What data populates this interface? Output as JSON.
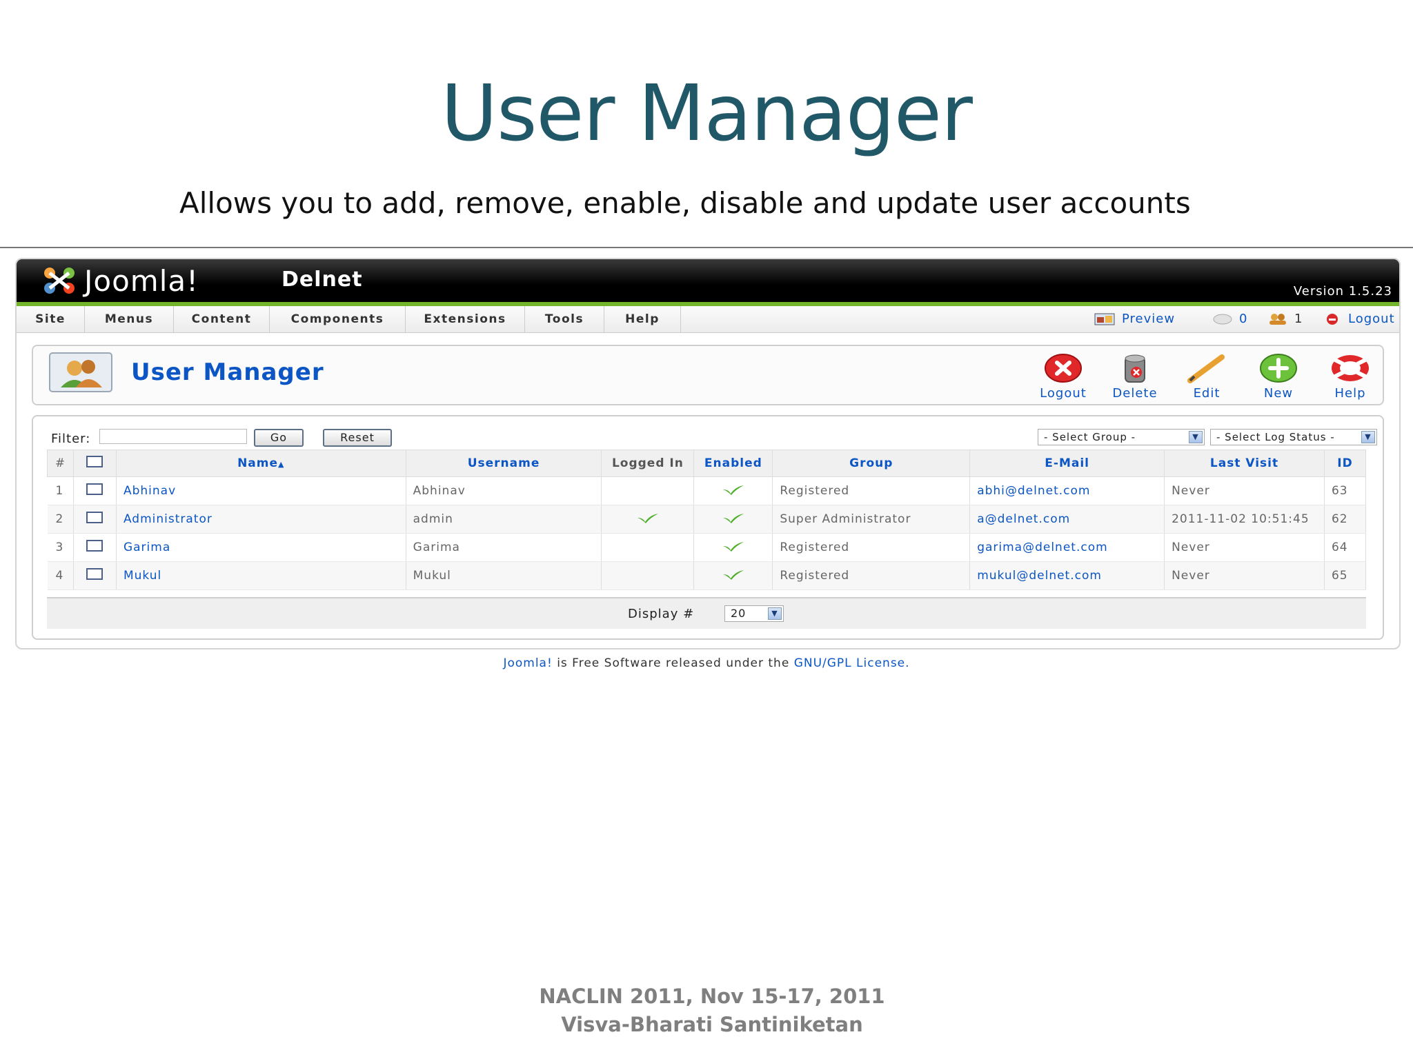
{
  "slide": {
    "title": "User Manager",
    "subtitle": "Allows you to add, remove, enable, disable and update user accounts",
    "footer_line1": "NACLIN 2011, Nov 15-17, 2011",
    "footer_line2": "Visva-Bharati Santiniketan"
  },
  "app": {
    "logo_text": "Joomla!",
    "site_name": "Delnet",
    "version": "Version 1.5.23"
  },
  "menu": [
    "Site",
    "Menus",
    "Content",
    "Components",
    "Extensions",
    "Tools",
    "Help"
  ],
  "status": {
    "preview": "Preview",
    "messages": "0",
    "users_online": "1",
    "logout": "Logout"
  },
  "header": {
    "title": "User Manager"
  },
  "toolbar": {
    "logout": "Logout",
    "delete": "Delete",
    "edit": "Edit",
    "new": "New",
    "help": "Help"
  },
  "filter": {
    "label": "Filter:",
    "value": "",
    "go": "Go",
    "reset": "Reset",
    "group_select": "- Select Group -",
    "log_status_select": "- Select Log Status -"
  },
  "table": {
    "columns": [
      "#",
      "",
      "Name",
      "Username",
      "Logged In",
      "Enabled",
      "Group",
      "E-Mail",
      "Last Visit",
      "ID"
    ],
    "rows": [
      {
        "num": "1",
        "name": "Abhinav",
        "username": "Abhinav",
        "logged_in": false,
        "enabled": true,
        "group": "Registered",
        "email": "abhi@delnet.com",
        "last_visit": "Never",
        "id": "63"
      },
      {
        "num": "2",
        "name": "Administrator",
        "username": "admin",
        "logged_in": true,
        "enabled": true,
        "group": "Super Administrator",
        "email": "a@delnet.com",
        "last_visit": "2011-11-02 10:51:45",
        "id": "62"
      },
      {
        "num": "3",
        "name": "Garima",
        "username": "Garima",
        "logged_in": false,
        "enabled": true,
        "group": "Registered",
        "email": "garima@delnet.com",
        "last_visit": "Never",
        "id": "64"
      },
      {
        "num": "4",
        "name": "Mukul",
        "username": "Mukul",
        "logged_in": false,
        "enabled": true,
        "group": "Registered",
        "email": "mukul@delnet.com",
        "last_visit": "Never",
        "id": "65"
      }
    ]
  },
  "pager": {
    "label": "Display #",
    "value": "20"
  },
  "footer_note": {
    "joomla_link": "Joomla!",
    "middle": " is Free Software released under the ",
    "license_link": "GNU/GPL License."
  },
  "colors": {
    "title": "#215868",
    "link": "#0b55c4",
    "green_bar": "#73b42b"
  }
}
